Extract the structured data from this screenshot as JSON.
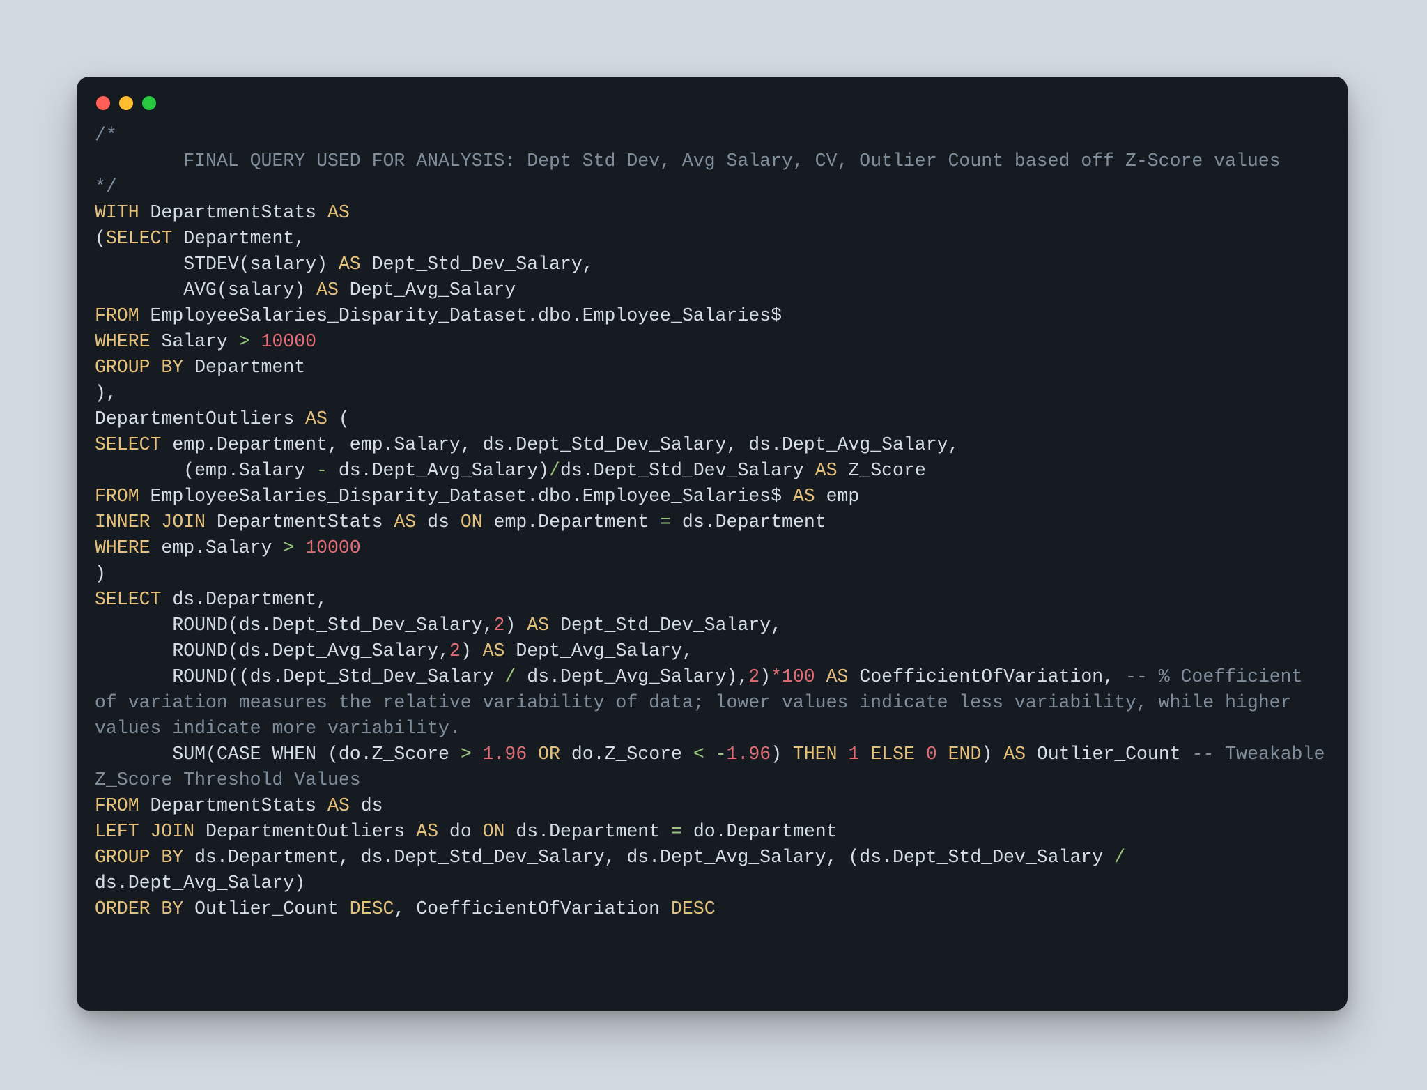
{
  "window": {
    "traffic": {
      "red": "#ff5f57",
      "yellow": "#febc2e",
      "green": "#28c840"
    }
  },
  "sql": {
    "comment_open": "/*",
    "comment_body": "        FINAL QUERY USED FOR ANALYSIS: Dept Std Dev, Avg Salary, CV, Outlier Count based off Z-Score values",
    "comment_close": "*/",
    "l01a": "WITH",
    "l01b": " DepartmentStats ",
    "l01c": "AS",
    "l02a": "(",
    "l02b": "SELECT",
    "l02c": " Department,",
    "l03a": "        STDEV(salary) ",
    "l03b": "AS",
    "l03c": " Dept_Std_Dev_Salary,",
    "l04a": "        AVG(salary) ",
    "l04b": "AS",
    "l04c": " Dept_Avg_Salary",
    "l05a": "FROM",
    "l05b": " EmployeeSalaries_Disparity_Dataset.dbo.Employee_Salaries$",
    "l06a": "WHERE",
    "l06b": " Salary ",
    "l06c": ">",
    "l06d": " ",
    "l06e": "10000",
    "l07a": "GROUP BY",
    "l07b": " Department",
    "l08": "),",
    "l09a": "DepartmentOutliers ",
    "l09b": "AS",
    "l09c": " (",
    "l10a": "SELECT",
    "l10b": " emp.Department, emp.Salary, ds.Dept_Std_Dev_Salary, ds.Dept_Avg_Salary,",
    "l11a": "        (emp.Salary ",
    "l11b": "-",
    "l11c": " ds.Dept_Avg_Salary)",
    "l11d": "/",
    "l11e": "ds.Dept_Std_Dev_Salary ",
    "l11f": "AS",
    "l11g": " Z_Score",
    "l12a": "FROM",
    "l12b": " EmployeeSalaries_Disparity_Dataset.dbo.Employee_Salaries$ ",
    "l12c": "AS",
    "l12d": " emp",
    "l13a": "INNER",
    "l13b": " ",
    "l13c": "JOIN",
    "l13d": " DepartmentStats ",
    "l13e": "AS",
    "l13f": " ds ",
    "l13g": "ON",
    "l13h": " emp.Department ",
    "l13i": "=",
    "l13j": " ds.Department",
    "l14a": "WHERE",
    "l14b": " emp.Salary ",
    "l14c": ">",
    "l14d": " ",
    "l14e": "10000",
    "l15": ")",
    "l16a": "SELECT",
    "l16b": " ds.Department,",
    "l17a": "       ROUND(ds.Dept_Std_Dev_Salary,",
    "l17b": "2",
    "l17c": ") ",
    "l17d": "AS",
    "l17e": " Dept_Std_Dev_Salary,",
    "l18a": "       ROUND(ds.Dept_Avg_Salary,",
    "l18b": "2",
    "l18c": ") ",
    "l18d": "AS",
    "l18e": " Dept_Avg_Salary,",
    "l19a": "       ROUND((ds.Dept_Std_Dev_Salary ",
    "l19b": "/",
    "l19c": " ds.Dept_Avg_Salary),",
    "l19d": "2",
    "l19e": ")",
    "l19f": "*",
    "l19g": "100",
    "l19h": " ",
    "l19i": "AS",
    "l19j": " CoefficientOfVariation, ",
    "l19k": "-- % Coefficient of variation measures the relative variability of data; lower values indicate less variability, while higher values indicate more variability.",
    "l20a": "       SUM(",
    "l20b": "CASE WHEN",
    "l20c": " (do.Z_Score ",
    "l20d": ">",
    "l20e": " ",
    "l20f": "1.96",
    "l20g": " ",
    "l20h": "OR",
    "l20i": " do.Z_Score ",
    "l20j": "<",
    "l20k": " ",
    "l20l": "-",
    "l20m": "1.96",
    "l20n": ") ",
    "l20o": "THEN",
    "l20p": " ",
    "l20q": "1",
    "l20r": " ",
    "l20s": "ELSE",
    "l20t": " ",
    "l20u": "0",
    "l20v": " ",
    "l20w": "END",
    "l20x": ") ",
    "l20y": "AS",
    "l20z": " Outlier_Count ",
    "l20comment": "-- Tweakable Z_Score Threshold Values",
    "l21a": "FROM",
    "l21b": " DepartmentStats ",
    "l21c": "AS",
    "l21d": " ds",
    "l22a": "LEFT",
    "l22b": " ",
    "l22c": "JOIN",
    "l22d": " DepartmentOutliers ",
    "l22e": "AS",
    "l22f": " do ",
    "l22g": "ON",
    "l22h": " ds.Department ",
    "l22i": "=",
    "l22j": " do.Department",
    "l23a": "GROUP BY",
    "l23b": " ds.Department, ds.Dept_Std_Dev_Salary, ds.Dept_Avg_Salary, (ds.Dept_Std_Dev_Salary ",
    "l23c": "/",
    "l23d": " ds.Dept_Avg_Salary)",
    "l24a": "ORDER BY",
    "l24b": " Outlier_Count ",
    "l24c": "DESC",
    "l24d": ", CoefficientOfVariation ",
    "l24e": "DESC"
  }
}
